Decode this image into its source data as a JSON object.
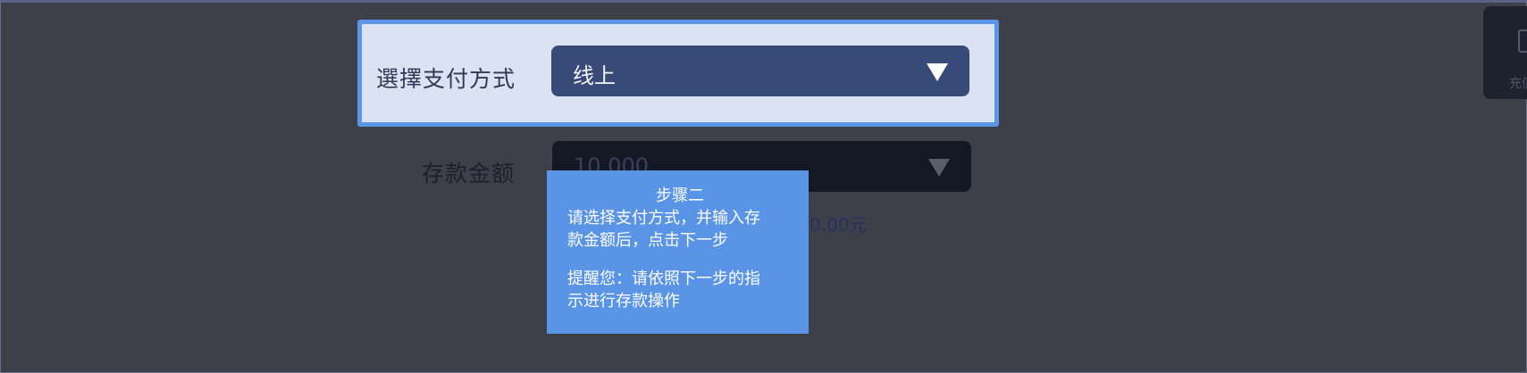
{
  "payment": {
    "label": "選擇支付方式",
    "selected": "线上"
  },
  "amount": {
    "label": "存款金额",
    "value": "10,000",
    "hint": "0.00元"
  },
  "side_widget": {
    "icon": "wallet-icon",
    "label": "充值"
  },
  "tooltip": {
    "title": "步骤二",
    "line1": "请选择支付方式，并输入存",
    "line2": "款金额后，点击下一步",
    "line3": "提醒您：请依照下一步的指",
    "line4": "示进行存款操作"
  },
  "colors": {
    "highlight_border": "#5b95e8",
    "highlight_bg": "#dbe3f2",
    "select_bg": "#384a77",
    "tooltip_bg": "#5a94e6",
    "overlay_bg": "#3a3d44"
  }
}
